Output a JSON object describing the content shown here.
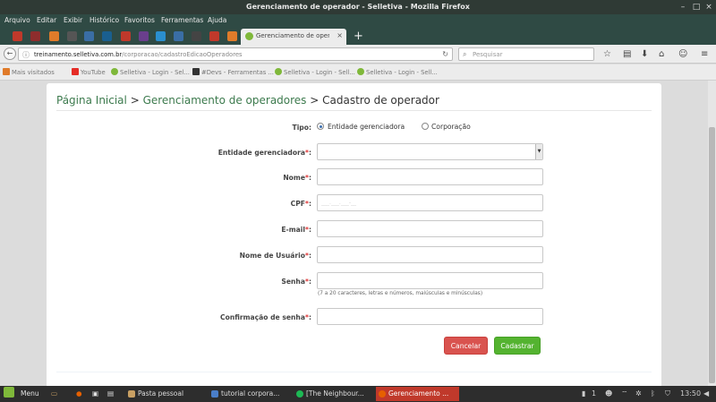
{
  "window": {
    "title": "Gerenciamento de operador - Selletiva - Mozilla Firefox"
  },
  "menubar": {
    "items": [
      "Arquivo",
      "Editar",
      "Exibir",
      "Histórico",
      "Favoritos",
      "Ferramentas",
      "Ajuda"
    ]
  },
  "tabs": {
    "active_title": "Gerenciamento de opera...",
    "new_tab": "+"
  },
  "navbar": {
    "url_domain": "treinamento.selletiva.com.br",
    "url_path": "/corporacao/cadastroEdicaoOperadores",
    "search_placeholder": "Pesquisar"
  },
  "bookmarks": [
    {
      "label": "Mais visitados",
      "color": "#e07b2a"
    },
    {
      "label": "YouTube",
      "color": "#e52d27"
    },
    {
      "label": "Selletiva - Login - Sel...",
      "color": "#7fb83a"
    },
    {
      "label": "#Devs - Ferramentas ...",
      "color": "#333333"
    },
    {
      "label": "Selletiva - Login - Sell...",
      "color": "#7fb83a"
    },
    {
      "label": "Selletiva - Login - Sell...",
      "color": "#7fb83a"
    }
  ],
  "breadcrumb": {
    "home": "Página Inicial",
    "sep1": " > ",
    "section": "Gerenciamento de operadores",
    "sep2": " > ",
    "current": "Cadastro de operador"
  },
  "form": {
    "tipo_label": "Tipo:",
    "tipo_options": [
      "Entidade gerenciadora",
      "Corporação"
    ],
    "tipo_selected": "Entidade gerenciadora",
    "entidade_label": "Entidade gerenciadora",
    "nome_label": "Nome",
    "cpf_label": "CPF",
    "cpf_mask": "___.___.___-__",
    "email_label": "E-mail",
    "usuario_label": "Nome de Usuário",
    "senha_label": "Senha",
    "senha_hint": "(7 a 20 caracteres, letras e números, maiúsculas e minúsculas)",
    "confirmacao_label": "Confirmação de senha",
    "required_mark": "*",
    "colon": ":",
    "cancel_label": "Cancelar",
    "submit_label": "Cadastrar"
  },
  "taskbar": {
    "menu_label": "Menu",
    "windows": [
      {
        "label": "Pasta pessoal",
        "color": "#c9a063",
        "active": false
      },
      {
        "label": "tutorial corpora...",
        "color": "#4a7ec9",
        "active": false
      },
      {
        "label": "[The Neighbour...",
        "color": "#1db954",
        "active": false
      },
      {
        "label": "Gerenciamento ...",
        "color": "#e66000",
        "active": true
      }
    ],
    "workspace": "1",
    "clock": "13:50"
  },
  "colors": {
    "accent_green": "#3c7a4d",
    "required_red": "#dd3333",
    "cancel_red": "#d9534f",
    "submit_green": "#54b330"
  }
}
